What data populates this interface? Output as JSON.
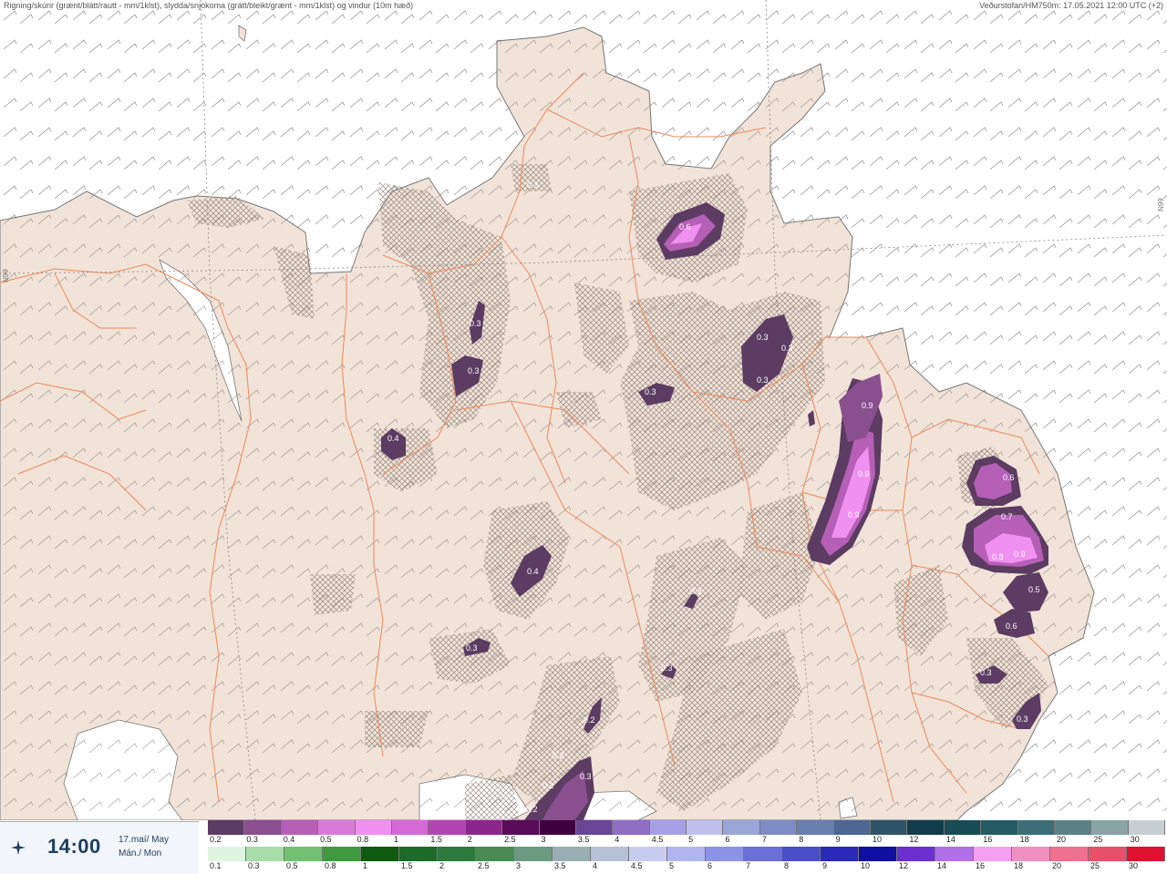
{
  "header": {
    "left_title": "Rigning/skúrir (grænt/blátt/rautt - mm/1klst), slydda/snjókoma (grátt/bleikt/grænt - mm/1klst) og vindur (10m hæð)",
    "right_title": "Veðurstofan/HM750m: 17.05.2021 12:00 UTC (+2)"
  },
  "map_labels": {
    "lat_left": "N99",
    "lat_right": "N99",
    "precip_values": [
      "0.2",
      "0.6",
      "0.3",
      "0.3",
      "0.3",
      "0.3",
      "0.3",
      "0.3",
      "0.4",
      "0.9",
      "0.9",
      "0.9",
      "0.6",
      "0.7",
      "0.8",
      "0.9",
      "0.4",
      "0.5",
      "0.6",
      "0.3",
      "0.3",
      "0.3",
      "0.3",
      "0.2",
      "0.2",
      "0.2",
      "0.2",
      "0.3",
      "0.3"
    ]
  },
  "time": {
    "value": "14:00",
    "date_line1": "17.maí/ May",
    "date_line2": "Mán./ Mon"
  },
  "legend": {
    "snow": {
      "labels": [
        "0.2",
        "0.3",
        "0.4",
        "0.5",
        "0.8",
        "1",
        "1.5",
        "2",
        "2.5",
        "3",
        "3.5",
        "4",
        "4.5",
        "5",
        "6",
        "7",
        "8",
        "9",
        "10",
        "12",
        "14",
        "16",
        "18",
        "20",
        "25",
        "30"
      ],
      "colors": [
        "#5c3c62",
        "#8a4f8e",
        "#b65fb6",
        "#d97ad9",
        "#f090f0",
        "#d66ad6",
        "#b146b1",
        "#8b268b",
        "#5a0b5a",
        "#3f0040",
        "#6a4596",
        "#8e6fc4",
        "#a8a0e6",
        "#bfbff0",
        "#9aa6d8",
        "#7d8cc4",
        "#6a7fb0",
        "#4d6694",
        "#2e5468",
        "#133c4a",
        "#1a4c56",
        "#255c64",
        "#3b6e76",
        "#5a8284",
        "#8aa3a6",
        "#c6d0d2"
      ]
    },
    "rain": {
      "labels": [
        "0.1",
        "0.3",
        "0.5",
        "0.8",
        "1",
        "1.5",
        "2",
        "2.5",
        "3",
        "3.5",
        "4",
        "4.5",
        "5",
        "6",
        "7",
        "8",
        "9",
        "10",
        "12",
        "14",
        "16",
        "18",
        "20",
        "25",
        "30"
      ],
      "colors": [
        "#dff5df",
        "#a8dca8",
        "#73c073",
        "#3f9a3f",
        "#0f5a0f",
        "#1d6a2a",
        "#2e7a3e",
        "#4a8a56",
        "#6c9a80",
        "#98aeb2",
        "#b8c0d8",
        "#c8ccf0",
        "#b0b4f0",
        "#8c92e6",
        "#6a70d8",
        "#4a4ec8",
        "#2a2ab8",
        "#1010a0",
        "#6a30d0",
        "#b070e8",
        "#f4a0f0",
        "#f090c0",
        "#f07090",
        "#e8506a",
        "#e01030"
      ]
    }
  }
}
